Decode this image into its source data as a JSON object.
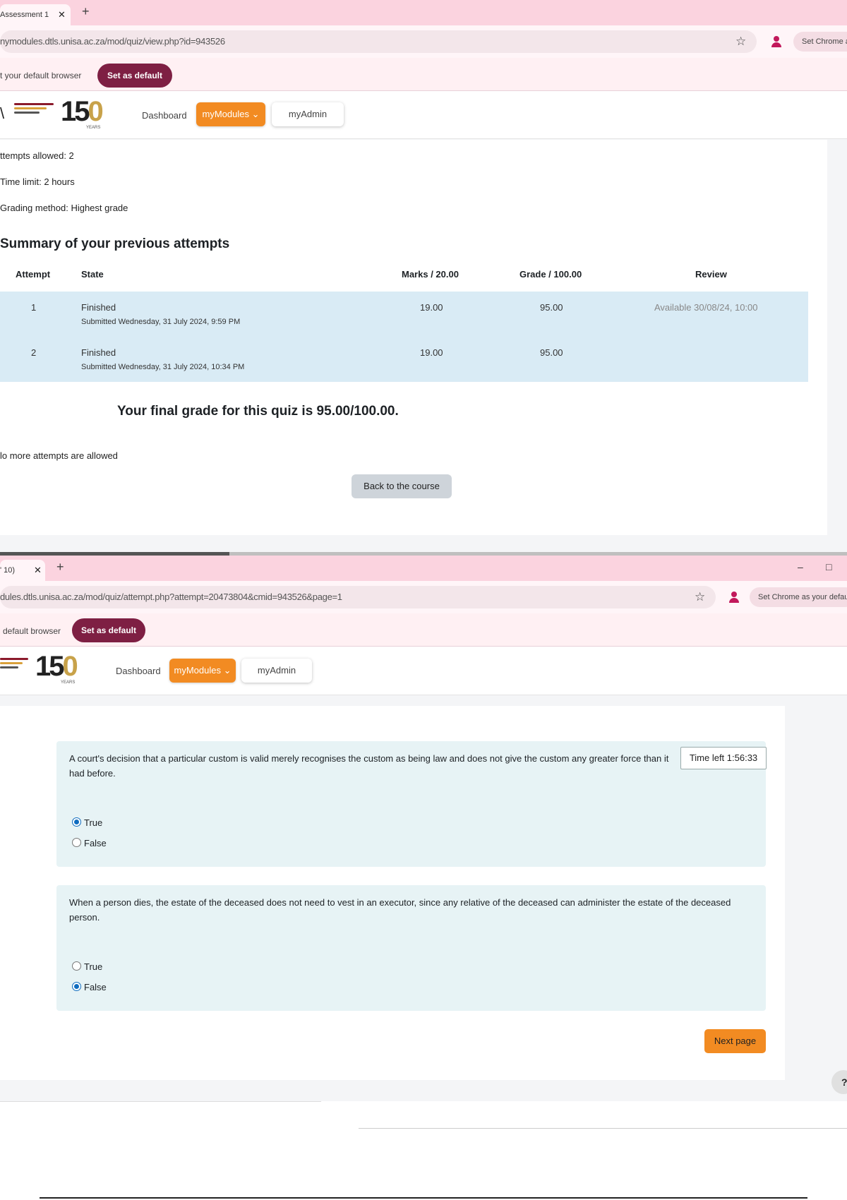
{
  "window1": {
    "tab_title": "Assessment 1",
    "url": "nymodules.dtls.unisa.ac.za/mod/quiz/view.php?id=943526",
    "set_chrome_label": "Set Chrome a",
    "infobar_text": "t your default browser",
    "set_default_label": "Set as default",
    "nav": {
      "dashboard": "Dashboard",
      "mymodules": "myModules ⌄",
      "myadmin": "myAdmin"
    }
  },
  "quiz_info": {
    "attempts_allowed": "ttempts allowed: 2",
    "time_limit": "Time limit: 2 hours",
    "grading_method": "Grading method: Highest grade"
  },
  "summary": {
    "heading": "Summary of your previous attempts",
    "headers": {
      "attempt": "Attempt",
      "state": "State",
      "marks": "Marks / 20.00",
      "grade": "Grade / 100.00",
      "review": "Review"
    },
    "rows": [
      {
        "attempt": "1",
        "state": "Finished",
        "submitted": "Submitted Wednesday, 31 July 2024, 9:59 PM",
        "marks": "19.00",
        "grade": "95.00",
        "review": "Available 30/08/24, 10:00"
      },
      {
        "attempt": "2",
        "state": "Finished",
        "submitted": "Submitted Wednesday, 31 July 2024, 10:34 PM",
        "marks": "19.00",
        "grade": "95.00",
        "review": ""
      }
    ],
    "final_grade": "Your final grade for this quiz is 95.00/100.00.",
    "no_more": "lo more attempts are allowed",
    "back_button": "Back to the course"
  },
  "window2": {
    "tab_title": "' 10)",
    "url": "dules.dtls.unisa.ac.za/mod/quiz/attempt.php?attempt=20473804&cmid=943526&page=1",
    "set_chrome_label": "Set Chrome as your defau",
    "infobar_text": "default browser",
    "set_default_label": "Set as default",
    "nav": {
      "dashboard": "Dashboard",
      "mymodules": "myModules ⌄",
      "myadmin": "myAdmin"
    },
    "minimize": "–",
    "maximize": "□"
  },
  "questions": [
    {
      "text": "A court's decision that a particular custom is valid merely recognises the custom as being law and does not give the custom any greater force than it had before.",
      "options": [
        {
          "label": "True",
          "selected": true
        },
        {
          "label": "False",
          "selected": false
        }
      ]
    },
    {
      "text": "When a person dies, the estate of the deceased does not need to vest in an executor, since any relative of the deceased can administer the estate of the deceased person.",
      "options": [
        {
          "label": "True",
          "selected": false
        },
        {
          "label": "False",
          "selected": true
        }
      ]
    }
  ],
  "timer": "Time left 1:56:33",
  "next_page": "Next page",
  "help_label": "?",
  "icons": {
    "close": "close-icon",
    "new_tab": "plus-icon",
    "bookmark": "star-icon",
    "profile": "profile-icon"
  }
}
